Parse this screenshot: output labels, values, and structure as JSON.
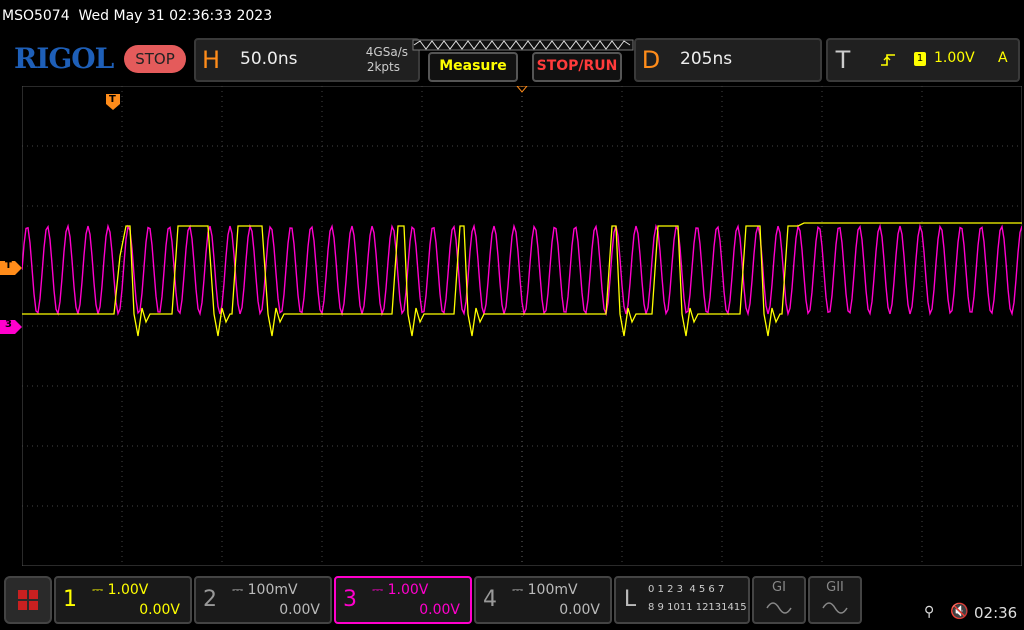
{
  "titlebar": {
    "model": "MSO5074",
    "datetime": "Wed May 31 02:36:33 2023"
  },
  "header": {
    "logo": "RIGOL",
    "run_state": "STOP",
    "horizontal": {
      "letter": "H",
      "timebase": "50.0ns",
      "sample_rate": "4GSa/s",
      "memory": "2kpts"
    },
    "measure_label": "Measure",
    "stoprun_label": "STOP/RUN",
    "delay": {
      "letter": "D",
      "value": "205ns"
    },
    "trigger": {
      "letter": "T",
      "channel": "1",
      "level": "1.00V",
      "mode": "A"
    }
  },
  "markers": {
    "trigger_top": "T",
    "trigger_left": "T",
    "ch3_left": "3"
  },
  "channels": [
    {
      "num": "1",
      "scale": "1.00V",
      "offset": "0.00V",
      "active": true,
      "color": "#ffff00"
    },
    {
      "num": "2",
      "scale": "100mV",
      "offset": "0.00V",
      "active": false,
      "color": "#888888"
    },
    {
      "num": "3",
      "scale": "1.00V",
      "offset": "0.00V",
      "active": true,
      "color": "#ff00cc"
    },
    {
      "num": "4",
      "scale": "100mV",
      "offset": "0.00V",
      "active": false,
      "color": "#888888"
    }
  ],
  "logic": {
    "letter": "L",
    "row1": "0 1 2 3  4 5 6 7",
    "row2": "8 9 1011 12131415"
  },
  "gen": [
    {
      "label": "GI"
    },
    {
      "label": "GII"
    }
  ],
  "status": {
    "time": "02:36"
  },
  "colors": {
    "ch1": "#ffff00",
    "ch3": "#ff00cc",
    "accent": "#ff8c1a",
    "logo": "#1e5fb8",
    "stop": "#e45b5b"
  }
}
